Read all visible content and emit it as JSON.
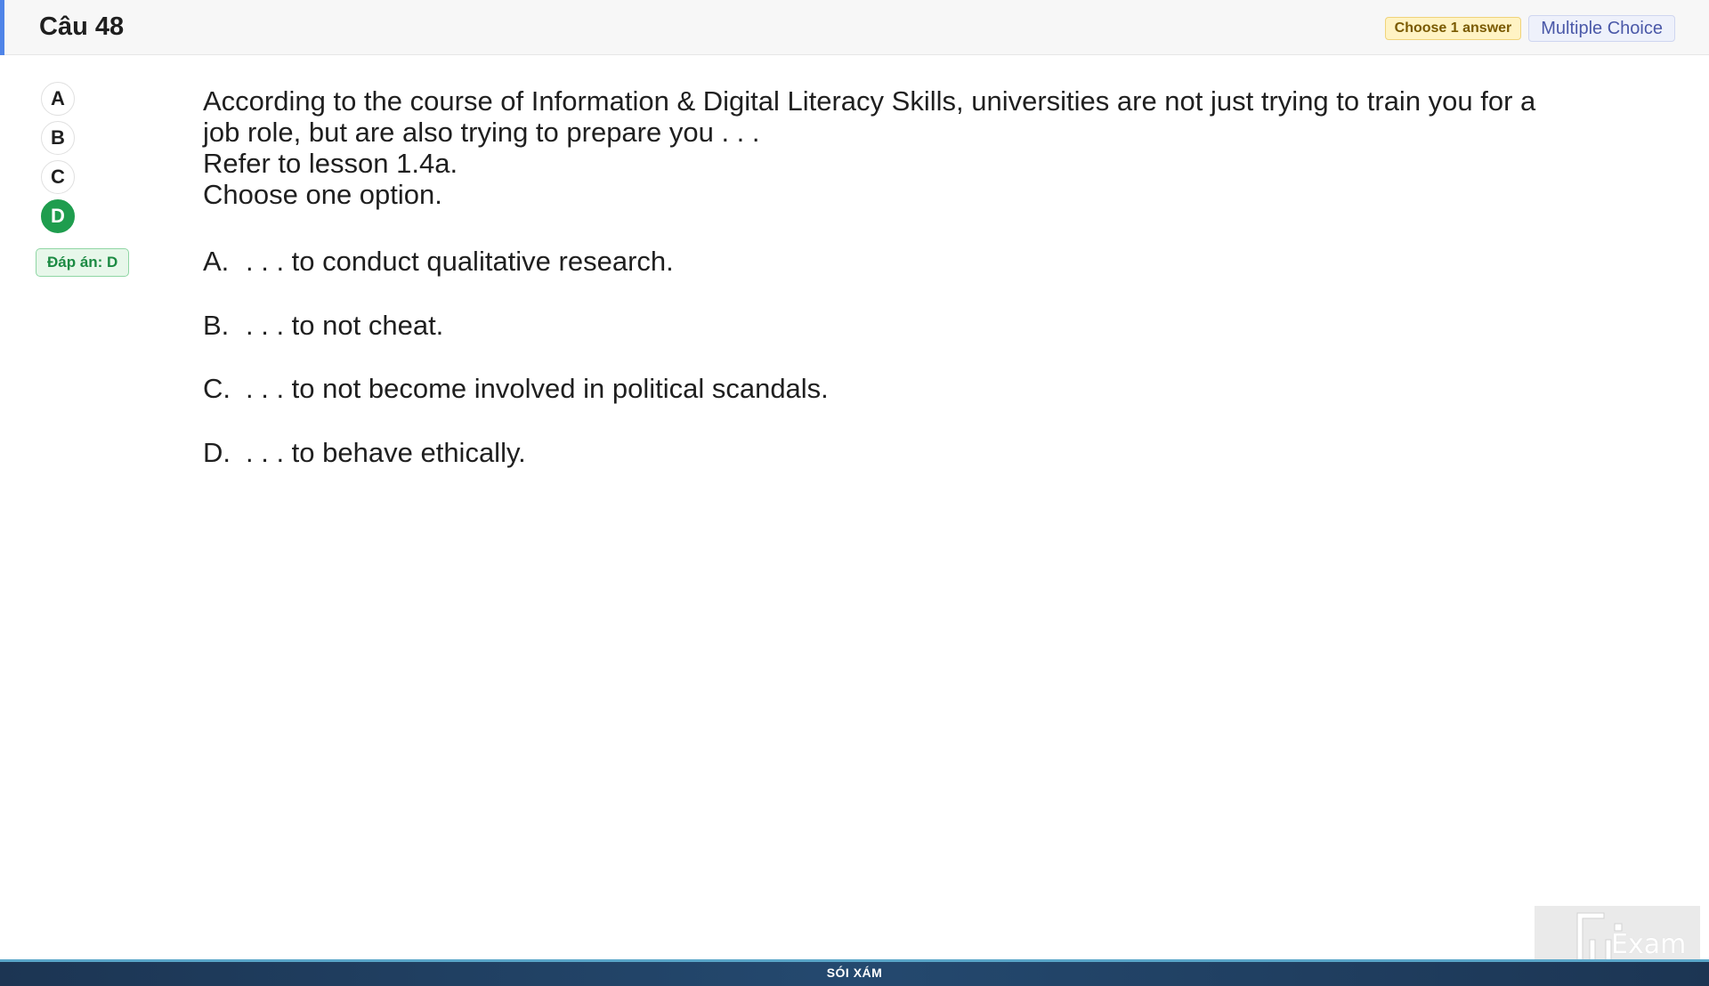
{
  "header": {
    "title": "Câu 48",
    "choose_badge": "Choose 1 answer",
    "type_badge": "Multiple Choice"
  },
  "options": {
    "letters": [
      "A",
      "B",
      "C",
      "D"
    ],
    "selected": "D",
    "answer_label": "Đáp án: D"
  },
  "question": {
    "lines": [
      "According to the course of Information & Digital Literacy Skills, universities are not just trying to train you for a",
      "job role, but are also trying to prepare you . . .",
      "Refer to lesson 1.4a.",
      "Choose one option."
    ],
    "choices": [
      {
        "letter": "A.",
        "text": ". . . to conduct qualitative research."
      },
      {
        "letter": "B.",
        "text": ". . . to not cheat."
      },
      {
        "letter": "C.",
        "text": ". . . to not become involved in political scandals."
      },
      {
        "letter": "D.",
        "text": ". . . to behave ethically."
      }
    ]
  },
  "footer": {
    "text": "SÓI XÁM"
  },
  "logo": {
    "word": "Exam",
    "icon": "fu-exam-logo-icon"
  },
  "colors": {
    "accent": "#4f84e8",
    "selected": "#1f9d4e",
    "footer": "#1c3553"
  }
}
